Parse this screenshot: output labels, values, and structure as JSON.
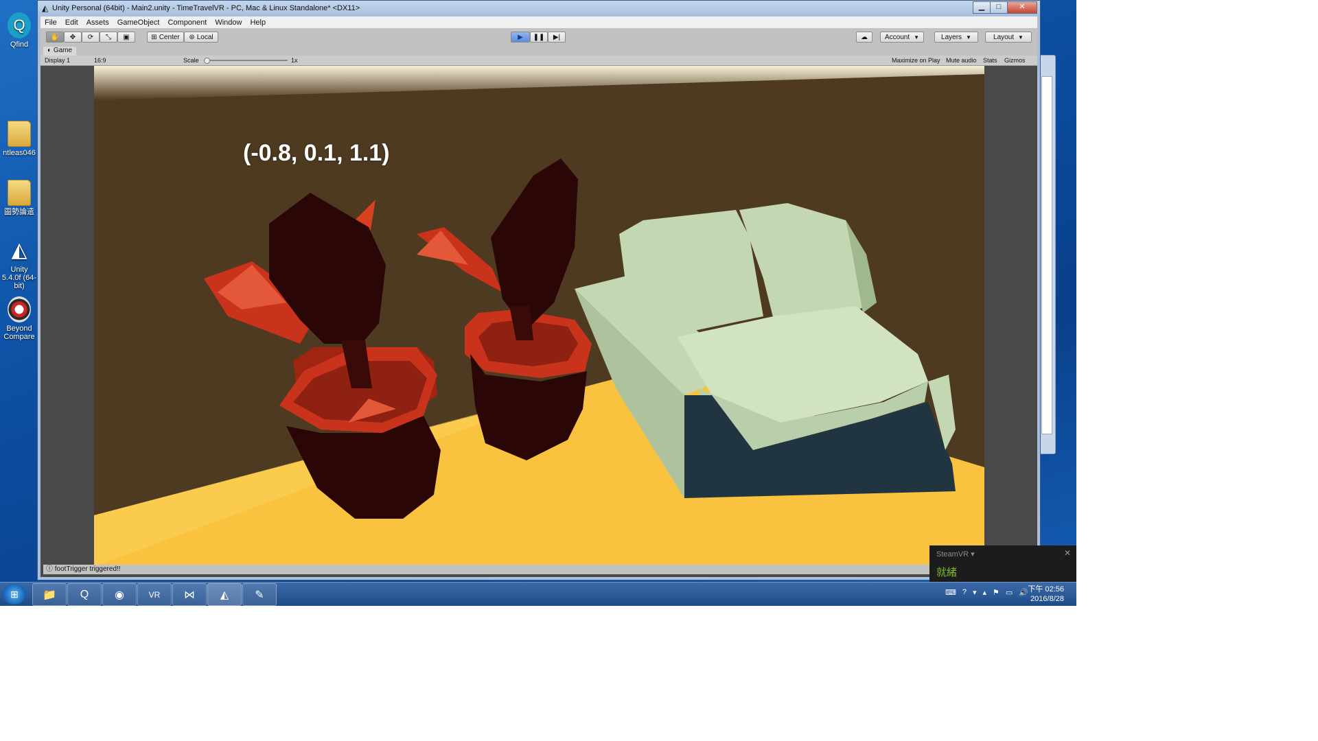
{
  "desktop": {
    "icons": [
      {
        "label": "Qfind",
        "icon": "qfind-app-icon"
      },
      {
        "label": "ntleas046",
        "icon": "folder-icon"
      },
      {
        "label": "圖勢論遣",
        "icon": "folder-icon"
      },
      {
        "label": "Unity 5.4.0f (64-bit)",
        "icon": "unity-icon"
      },
      {
        "label": "Beyond Compare",
        "icon": "beyond-compare-icon"
      }
    ]
  },
  "window": {
    "title": "Unity Personal (64bit) - Main2.unity - TimeTravelVR - PC, Mac & Linux Standalone* <DX11>",
    "buttons": {
      "minimize": "▁",
      "maximize": "□",
      "close": "✕"
    }
  },
  "menu": [
    "File",
    "Edit",
    "Assets",
    "GameObject",
    "Component",
    "Window",
    "Help"
  ],
  "toolbar": {
    "tools": [
      {
        "name": "hand-tool",
        "glyph": "✋"
      },
      {
        "name": "move-tool",
        "glyph": "✥"
      },
      {
        "name": "rotate-tool",
        "glyph": "⟳"
      },
      {
        "name": "scale-tool",
        "glyph": "⤡"
      },
      {
        "name": "rect-tool",
        "glyph": "▣"
      }
    ],
    "pivot_label": "Center",
    "pivot_glyph": "⊞",
    "space_label": "Local",
    "space_glyph": "⊛",
    "play_glyph": "▶",
    "pause_glyph": "❚❚",
    "step_glyph": "▶|",
    "cloud_glyph": "☁",
    "account_label": "Account",
    "layers_label": "Layers",
    "layout_label": "Layout"
  },
  "game": {
    "tab_label": "Game",
    "tab_glyph": "◐",
    "display": "Display 1",
    "aspect": "16:9",
    "scale_label": "Scale",
    "scale_value": "1x",
    "maximize_on_play": "Maximize on Play",
    "mute_audio": "Mute audio",
    "stats": "Stats",
    "gizmos": "Gizmos",
    "coordinates": "(-0.8, 0.1, 1.1)"
  },
  "status": {
    "message": "footTrigger triggered!!",
    "icon_glyph": "ⓘ"
  },
  "steamvr": {
    "title": "SteamVR ▾",
    "close": "✕",
    "status": "就緒"
  },
  "taskbar": {
    "start_glyph": "⊞",
    "apps": [
      {
        "name": "explorer",
        "glyph": "📁"
      },
      {
        "name": "qfind",
        "glyph": "Q"
      },
      {
        "name": "chrome",
        "glyph": "◉"
      },
      {
        "name": "vr",
        "glyph": "VR"
      },
      {
        "name": "visual-studio",
        "glyph": "⋈"
      },
      {
        "name": "unity",
        "glyph": "◭"
      },
      {
        "name": "paint",
        "glyph": "✎"
      }
    ],
    "tray": [
      "⌨",
      "?",
      "▾",
      "▴",
      "⚑",
      "▭",
      "🔊"
    ],
    "clock": {
      "time": "下午 02:56",
      "date": "2016/8/28"
    }
  },
  "colors": {
    "wall": "#4e3a21",
    "floor": "#f9c33f",
    "sofa": "#c3d7b3",
    "pot": "#cd3a1e",
    "leaf_dark": "#2a0606"
  }
}
